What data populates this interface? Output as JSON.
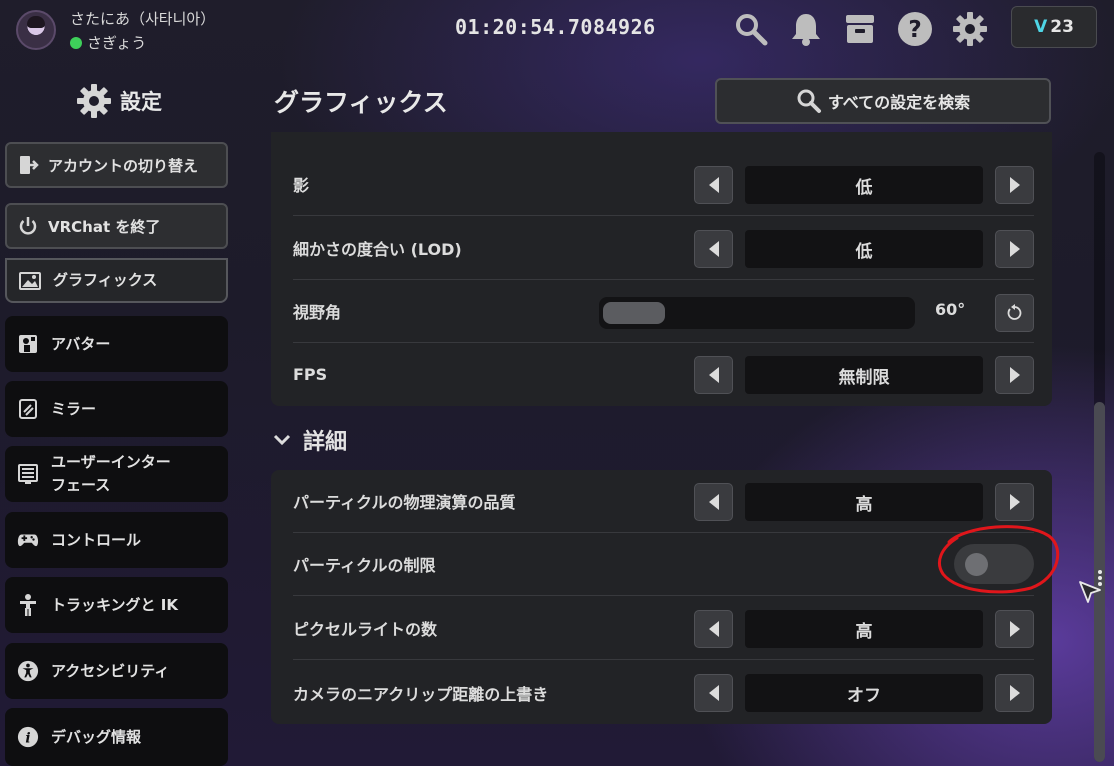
{
  "user": {
    "name": "さたにあ（사타니아）",
    "status": "さぎょう",
    "status_color": "#3ecf5a"
  },
  "clock": "01:20:54.7084926",
  "top_icons": [
    "search-icon",
    "bell-icon",
    "inbox-icon",
    "help-icon",
    "gear-icon"
  ],
  "version_badge": {
    "prefix": "V",
    "number": "23"
  },
  "sidebar": {
    "title": "設定",
    "switch_account": "アカウントの切り替え",
    "quit": "VRChat を終了",
    "items": [
      {
        "label": "グラフィックス",
        "icon": "image-icon",
        "active": true
      },
      {
        "label": "アバター",
        "icon": "avatar-icon"
      },
      {
        "label": "ミラー",
        "icon": "mirror-icon"
      },
      {
        "label": "ユーザーインターフェース",
        "line1": "ユーザーインター",
        "line2": "フェース",
        "icon": "ui-icon"
      },
      {
        "label": "コントロール",
        "icon": "gamepad-icon"
      },
      {
        "label": "トラッキングと IK",
        "icon": "tracking-icon"
      },
      {
        "label": "アクセシビリティ",
        "icon": "accessibility-icon"
      },
      {
        "label": "デバッグ情報",
        "icon": "info-icon"
      }
    ]
  },
  "main": {
    "title": "グラフィックス",
    "search_label": "すべての設定を検索",
    "panel1": [
      {
        "label": "影",
        "value": "低"
      },
      {
        "label": "細かさの度合い (LOD)",
        "value": "低"
      },
      {
        "label": "視野角",
        "value": "60°",
        "slider_fraction": 0.2
      },
      {
        "label": "FPS",
        "value": "無制限"
      }
    ],
    "section_title": "詳細",
    "panel2": [
      {
        "label": "パーティクルの物理演算の品質",
        "value": "高"
      },
      {
        "label": "パーティクルの制限",
        "toggle": false
      },
      {
        "label": "ピクセルライトの数",
        "value": "高"
      },
      {
        "label": "カメラのニアクリップ距離の上書き",
        "value": "オフ"
      }
    ]
  },
  "colors": {
    "accent_badge": "#4fd6e6",
    "annotation": "#e0161b"
  }
}
